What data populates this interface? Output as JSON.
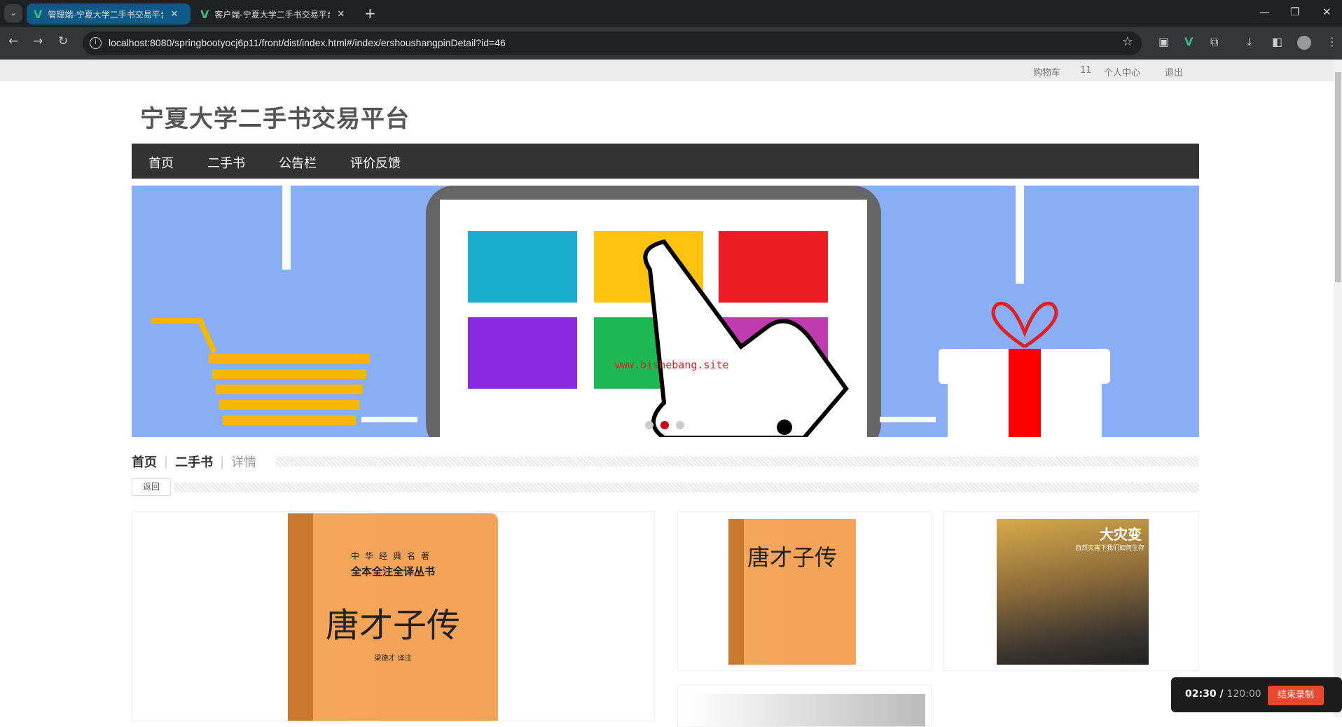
{
  "browser": {
    "tabs": [
      {
        "title": "管理端-宁夏大学二手书交易平台",
        "active": true
      },
      {
        "title": "客户端-宁夏大学二手书交易平台",
        "active": false
      }
    ],
    "url": "localhost:8080/springbootyocj6p11/front/dist/index.html#/index/ershoushangpinDetail?id=46"
  },
  "topbar": {
    "cart": "购物车",
    "cart_count": "11",
    "profile": "个人中心",
    "logout": "退出"
  },
  "site_title": "宁夏大学二手书交易平台",
  "nav": [
    "首页",
    "二手书",
    "公告栏",
    "评价反馈"
  ],
  "banner": {
    "watermark": "www.bishebang.site",
    "active_slide": 2,
    "slide_count": 3
  },
  "breadcrumb": {
    "home": "首页",
    "category": "二手书",
    "current": "详情"
  },
  "back_label": "返回",
  "books": {
    "main": {
      "series": "中华经典名著",
      "subtitle": "全本全注全译丛书",
      "title": "唐才子传",
      "author": "梁德才 译注"
    },
    "thumb1": {
      "title": "唐才子传"
    },
    "thumb2": {
      "title": "大灾变",
      "subtitle": "自然灾害下我们如何生存"
    }
  },
  "recorder": {
    "elapsed": "02:30 /",
    "total": "120:00",
    "stop_label": "结束录制"
  }
}
